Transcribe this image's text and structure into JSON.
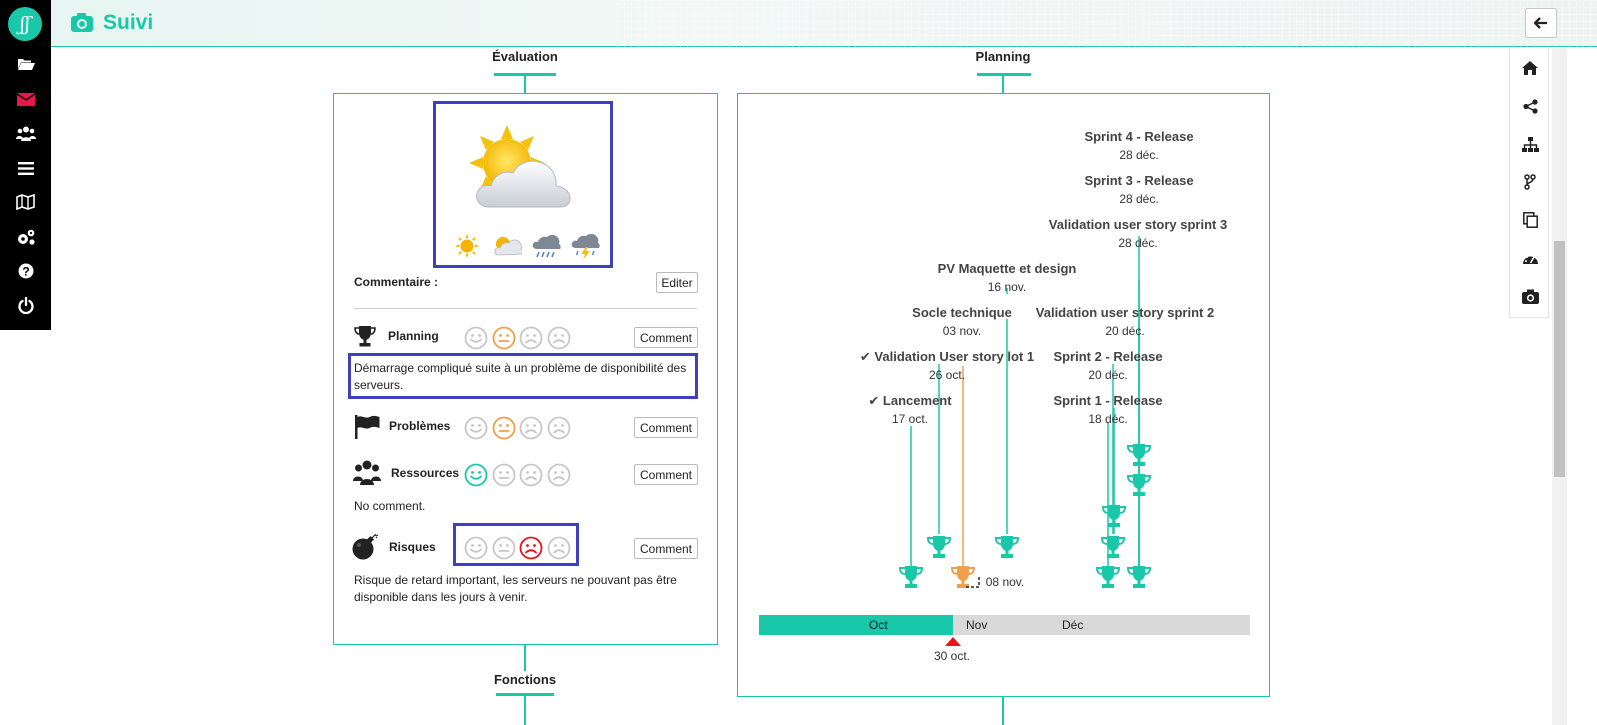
{
  "app": {
    "title": "Suivi",
    "logo_glyph": "ʃʃ",
    "accent": "#19c8a8",
    "highlight": "#3f3fc0"
  },
  "left_nav": [
    {
      "icon": "folder-open-icon"
    },
    {
      "icon": "envelope-icon",
      "color": "#e8174a"
    },
    {
      "icon": "users-icon"
    },
    {
      "icon": "list-icon"
    },
    {
      "icon": "map-icon"
    },
    {
      "icon": "cogs-icon"
    },
    {
      "icon": "help-icon"
    },
    {
      "icon": "power-icon"
    }
  ],
  "right_tools": [
    "home-icon",
    "share-icon",
    "sitemap-icon",
    "branch-icon",
    "copy-icon",
    "dashboard-icon",
    "camera-icon"
  ],
  "evaluation": {
    "title": "Évaluation",
    "weather_selected": "sun-behind-cloud",
    "weather_options": [
      "sunny",
      "sun-behind-cloud",
      "rain",
      "storm"
    ],
    "comment_label": "Commentaire :",
    "edit_button": "Editer",
    "criteria": [
      {
        "label": "Planning",
        "icon": "trophy-icon",
        "selected": 1,
        "selected_color": "#f0a04b",
        "button": "Comment",
        "note": "Démarrage compliqué suite à un problème de disponibilité des serveurs."
      },
      {
        "label": "Problèmes",
        "icon": "flag-icon",
        "selected": 1,
        "selected_color": "#f0a04b",
        "button": "Comment",
        "note": ""
      },
      {
        "label": "Ressources",
        "icon": "users-icon",
        "selected": 0,
        "selected_color": "#19c8a8",
        "button": "Comment",
        "note": "No comment."
      },
      {
        "label": "Risques",
        "icon": "bomb-icon",
        "selected": 2,
        "selected_color": "#e8141a",
        "button": "Comment",
        "note": "Risque de retard important, les serveurs ne pouvant pas être disponible dans les jours à venir."
      }
    ]
  },
  "planning": {
    "title": "Planning",
    "milestones": [
      {
        "name": "Sprint 4 - Release",
        "date": "28 déc.",
        "done": false
      },
      {
        "name": "Sprint 3 - Release",
        "date": "28 déc.",
        "done": false
      },
      {
        "name": "Validation user story sprint 3",
        "date": "28 déc.",
        "done": false
      },
      {
        "name": "PV Maquette et design",
        "date": "16 nov.",
        "done": false
      },
      {
        "name": "Socle technique",
        "date": "03 nov.",
        "done": false
      },
      {
        "name": "Validation user story sprint 2",
        "date": "20 déc.",
        "done": false
      },
      {
        "name": "✔ Validation User story lot 1",
        "date": "26 oct.",
        "done": true
      },
      {
        "name": "Sprint 2 - Release",
        "date": "20 déc.",
        "done": false
      },
      {
        "name": "✔ Lancement",
        "date": "17 oct.",
        "done": true
      },
      {
        "name": "Sprint 1 - Release",
        "date": "18 déc.",
        "done": false
      }
    ],
    "late_marker_date": "08 nov.",
    "months": [
      "Oct",
      "Nov",
      "Déc"
    ],
    "today": "30 oct."
  },
  "functions": {
    "title": "Fonctions"
  }
}
